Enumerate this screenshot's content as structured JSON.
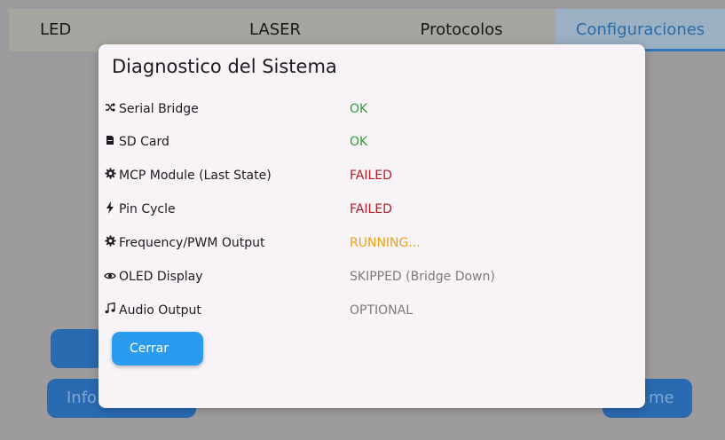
{
  "tabs": [
    {
      "label": "LED"
    },
    {
      "label": "LASER"
    },
    {
      "label": "Protocolos"
    },
    {
      "label": "Configuraciones",
      "active": true
    }
  ],
  "background_buttons": {
    "info_label": "Info",
    "right_label": "me"
  },
  "dialog": {
    "title": "Diagnostico del Sistema",
    "items": [
      {
        "icon": "shuffle-icon",
        "label": "Serial Bridge",
        "status": "OK",
        "status_color": "#2e9e3a"
      },
      {
        "icon": "sd-card-icon",
        "label": "SD Card",
        "status": "OK",
        "status_color": "#2e9e3a"
      },
      {
        "icon": "gear-icon",
        "label": "MCP Module (Last State)",
        "status": "FAILED",
        "status_color": "#b0202a"
      },
      {
        "icon": "bolt-icon",
        "label": "Pin Cycle",
        "status": "FAILED",
        "status_color": "#b0202a"
      },
      {
        "icon": "gear-icon",
        "label": "Frequency/PWM Output",
        "status": "RUNNING...",
        "status_color": "#e8a21a"
      },
      {
        "icon": "eye-icon",
        "label": "OLED Display",
        "status": "SKIPPED (Bridge Down)",
        "status_color": "#7d7a7e"
      },
      {
        "icon": "music-note-icon",
        "label": "Audio Output",
        "status": "OPTIONAL",
        "status_color": "#7d7a7e"
      }
    ],
    "close_label": "Cerrar"
  },
  "colors": {
    "accent": "#2b9bf0",
    "active_tab_text": "#2c6ca6",
    "ok": "#2e9e3a",
    "failed": "#b0202a",
    "running": "#e8a21a",
    "muted": "#7d7a7e"
  }
}
